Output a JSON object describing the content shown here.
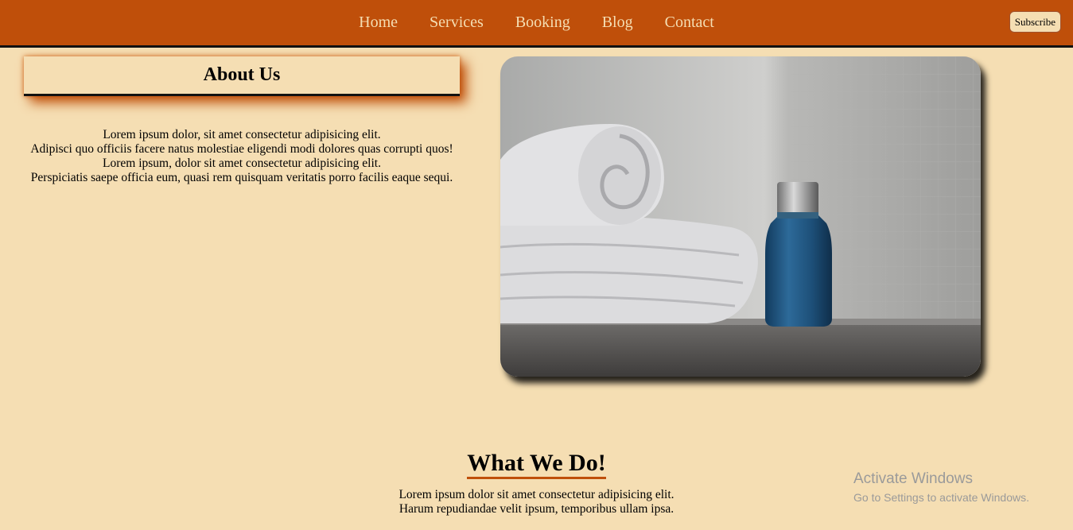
{
  "nav": {
    "links": [
      "Home",
      "Services",
      "Booking",
      "Blog",
      "Contact"
    ],
    "subscribe_label": "Subscribe"
  },
  "about": {
    "title": "About Us",
    "lines": [
      "Lorem ipsum dolor, sit amet consectetur adipisicing elit.",
      "Adipisci quo officiis facere natus molestiae eligendi modi dolores quas corrupti quos!",
      "Lorem ipsum, dolor sit amet consectetur adipisicing elit.",
      "Perspiciatis saepe officia eum, quasi rem quisquam veritatis porro facilis eaque sequi."
    ]
  },
  "hero_image": {
    "icon": "towel-and-bottle-photo"
  },
  "what_we_do": {
    "title": "What We Do!",
    "lines": [
      "Lorem ipsum dolor sit amet consectetur adipisicing elit.",
      "Harum repudiandae velit ipsum, temporibus ullam ipsa."
    ]
  },
  "watermark": {
    "title": "Activate Windows",
    "subtitle": "Go to Settings to activate Windows."
  },
  "colors": {
    "background": "#f5deb3",
    "nav": "#bf4f0a",
    "accent": "#bf4f0a"
  }
}
